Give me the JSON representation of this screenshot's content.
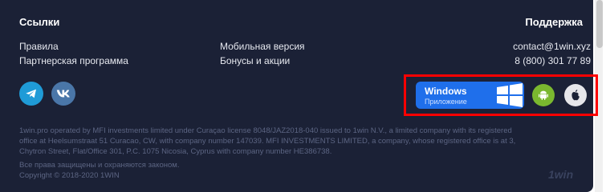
{
  "links": {
    "title": "Ссылки",
    "col1": [
      "Правила",
      "Партнерская программа"
    ],
    "col2": [
      "Мобильная версия",
      "Бонусы и акции"
    ]
  },
  "support": {
    "title": "Поддержка",
    "email": "contact@1win.xyz",
    "phone": "8 (800) 301 77 89"
  },
  "apps": {
    "windows_label": "Windows",
    "windows_sublabel": "Приложение",
    "highlight_color": "#ff0000"
  },
  "legal": {
    "line1": "1win.pro operated by MFI investments limited under Curaçao license 8048/JAZ2018-040 issued to 1win N.V., a limited company with its registered",
    "line2": "office at Heelsumstraat 51 Curacao, CW, with company number 147039. MFI INVESTMENTS LIMITED, a company, whose registered office is at 3,",
    "line3": "Chytron Street, Flat/Office 301, P.C. 1075 Nicosia, Cyprus with company number HE386738.",
    "rights": "Все права защищены и охраняются законом.",
    "copyright": "Copyright © 2018-2020 1WIN"
  },
  "brand": "1win",
  "icons": [
    "telegram-icon",
    "vk-icon",
    "windows-logo-icon",
    "android-icon",
    "apple-icon"
  ]
}
